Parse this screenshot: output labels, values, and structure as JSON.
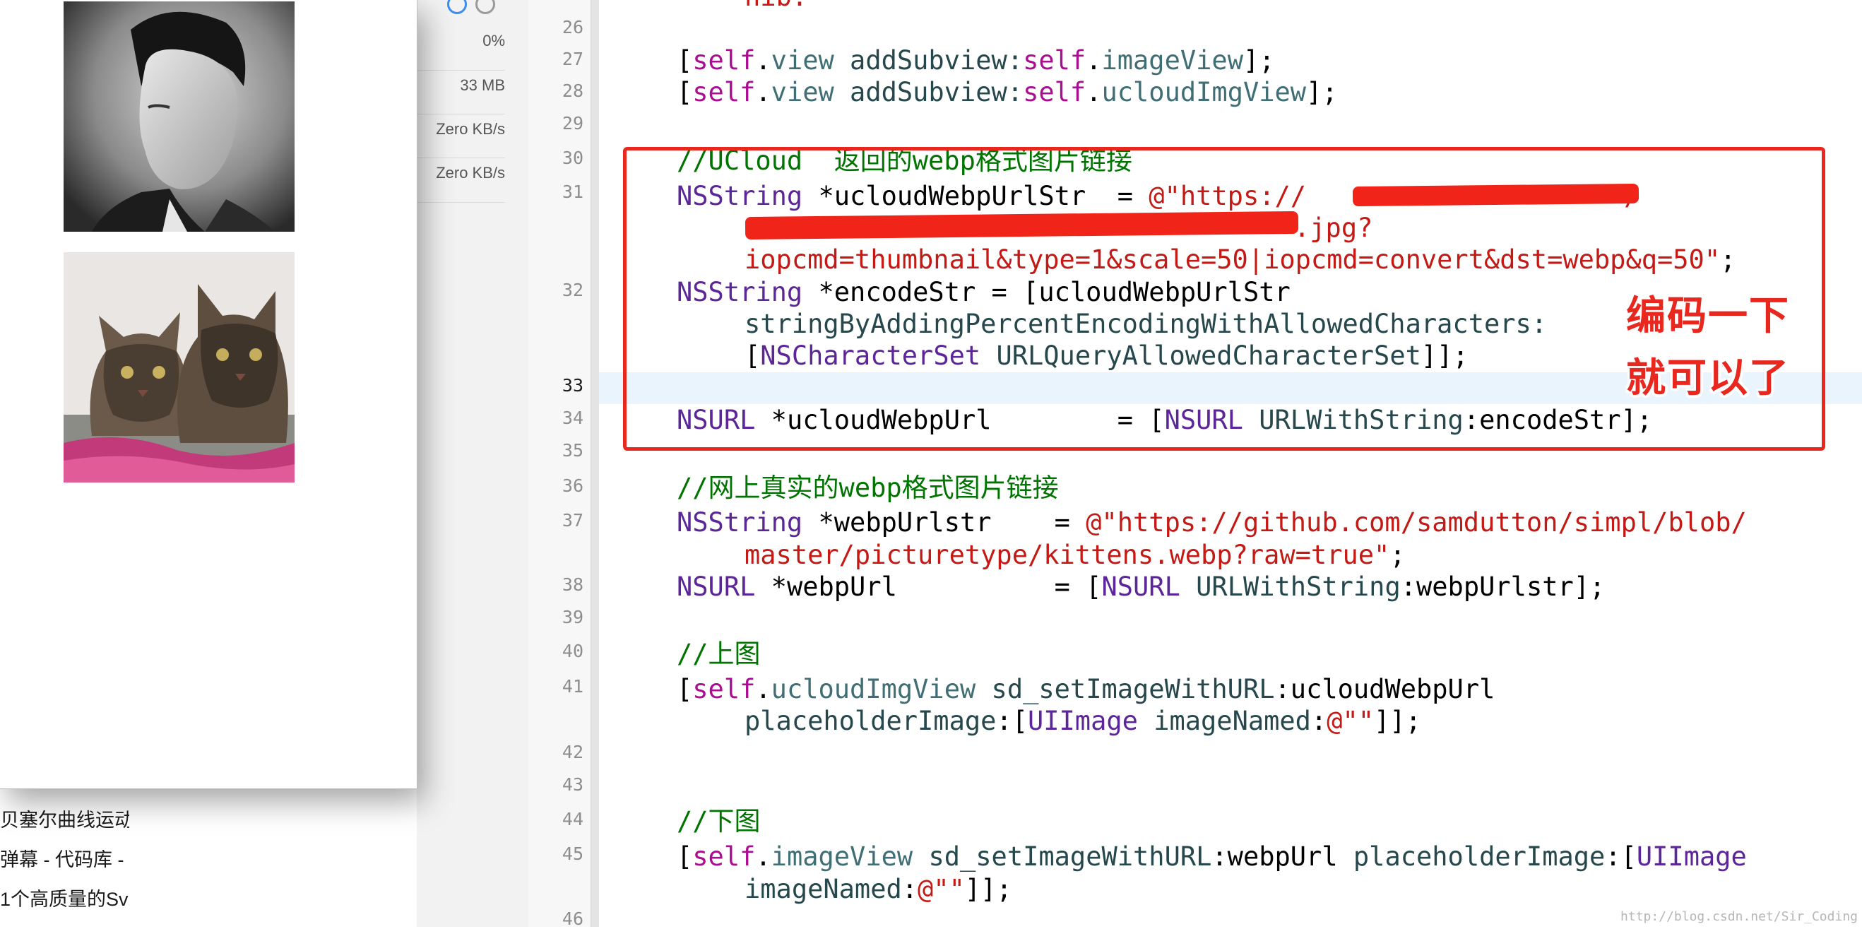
{
  "history": {
    "items": [
      {
        "label": "贝塞尔曲线运动"
      },
      {
        "label": "弹幕 - 代码库 -"
      },
      {
        "label": "1个高质量的Sv"
      }
    ]
  },
  "simulator": {
    "images": [
      {
        "name": "portrait-photo"
      },
      {
        "name": "kittens-photo"
      }
    ]
  },
  "debug_navigator": {
    "cpu": "0%",
    "memory": "33 MB",
    "network_in": "Zero KB/s",
    "network_out": "Zero KB/s"
  },
  "editor": {
    "line_numbers": [
      "26",
      "27",
      "28",
      "29",
      "30",
      "31",
      "32",
      "33",
      "34",
      "35",
      "36",
      "37",
      "38",
      "39",
      "40",
      "41",
      "42",
      "43",
      "44",
      "45",
      "46"
    ],
    "current_line": "33",
    "code": {
      "l25_tail": "nib.",
      "l27": [
        "[",
        "self",
        ".",
        "view",
        " addSubview:",
        "self",
        ".",
        "imageView",
        "];"
      ],
      "l28": [
        "[",
        "self",
        ".",
        "view",
        " addSubview:",
        "self",
        ".",
        "ucloudImgView",
        "];"
      ],
      "l30": "//UCloud  返回的webp格式图片链接",
      "l31a": [
        "NSString",
        " *ucloudWebpUrlStr  = ",
        "@\"https://",
        "/"
      ],
      "l31b": ".jpg?",
      "l31c": "iopcmd=thumbnail&type=1&scale=50|iopcmd=convert&dst=webp&q=50\"",
      "l31c_end": ";",
      "l32a": [
        "NSString",
        " *encodeStr = [ucloudWebpUrlStr"
      ],
      "l32b": "stringByAddingPercentEncodingWithAllowedCharacters:",
      "l32c": [
        "[",
        "NSCharacterSet",
        " ",
        "URLQueryAllowedCharacterSet",
        "]];"
      ],
      "l34": [
        "NSURL",
        " *ucloudWebpUrl        = [",
        "NSURL",
        " ",
        "URLWithString",
        ":encodeStr];"
      ],
      "l36": "//网上真实的webp格式图片链接",
      "l37a": [
        "NSString",
        " *webpUrlstr    = ",
        "@\"https://github.com/samdutton/simpl/blob/"
      ],
      "l37b": "master/picturetype/kittens.webp?raw=true\"",
      "l37b_end": ";",
      "l38": [
        "NSURL",
        " *webpUrl          = [",
        "NSURL",
        " ",
        "URLWithString",
        ":webpUrlstr];"
      ],
      "l40": "//上图",
      "l41a": [
        "[",
        "self",
        ".",
        "ucloudImgView",
        " ",
        "sd_setImageWithURL",
        ":ucloudWebpUrl"
      ],
      "l41b": [
        "placeholderImage",
        ":[",
        "UIImage",
        " ",
        "imageNamed",
        ":",
        "@\"\"",
        "]];"
      ],
      "l44": "//下图",
      "l45a": [
        "[",
        "self",
        ".",
        "imageView",
        " ",
        "sd_setImageWithURL",
        ":webpUrl ",
        "placeholderImage",
        ":[",
        "UIImage"
      ],
      "l45b": [
        "imageNamed",
        ":",
        "@\"\"",
        "]];"
      ]
    }
  },
  "annotation": {
    "line1": "编码一下",
    "line2": "就可以了",
    "color": "#e8271f"
  },
  "watermark": "http://blog.csdn.net/Sir_Coding",
  "colors": {
    "keyword": "#aa0d91",
    "property": "#3f6e74",
    "class": "#5c2699",
    "string": "#c41a16",
    "comment": "#007400"
  }
}
